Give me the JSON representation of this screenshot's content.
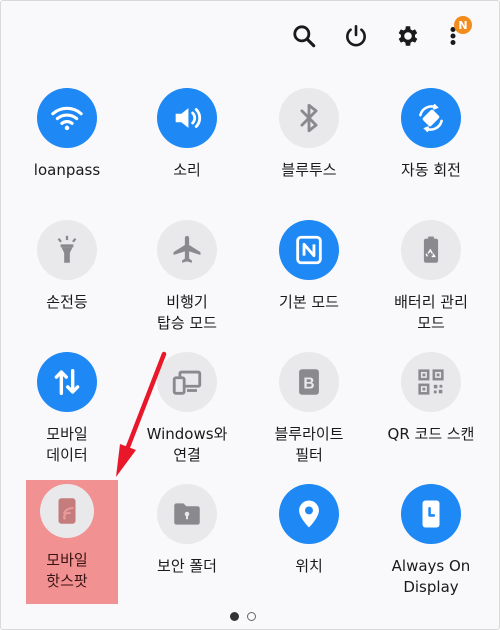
{
  "topbar": {
    "icons": [
      "search-icon",
      "power-icon",
      "settings-icon",
      "more-icon"
    ],
    "notification_badge": "N"
  },
  "tiles": [
    {
      "label": "loanpass",
      "icon": "wifi-icon",
      "state": "on"
    },
    {
      "label": "소리",
      "icon": "sound-icon",
      "state": "on"
    },
    {
      "label": "블루투스",
      "icon": "bluetooth-icon",
      "state": "off"
    },
    {
      "label": "자동 회전",
      "icon": "auto-rotate-icon",
      "state": "on"
    },
    {
      "label": "손전등",
      "icon": "flashlight-icon",
      "state": "off"
    },
    {
      "label": "비행기\n탑승 모드",
      "icon": "airplane-icon",
      "state": "off"
    },
    {
      "label": "기본 모드",
      "icon": "nfc-icon",
      "state": "on"
    },
    {
      "label": "배터리 관리\n모드",
      "icon": "battery-saver-icon",
      "state": "off"
    },
    {
      "label": "모바일\n데이터",
      "icon": "mobile-data-icon",
      "state": "on"
    },
    {
      "label": "Windows와\n연결",
      "icon": "link-to-windows-icon",
      "state": "off"
    },
    {
      "label": "블루라이트\n필터",
      "icon": "blue-light-filter-icon",
      "state": "off"
    },
    {
      "label": "QR 코드 스캔",
      "icon": "qr-code-icon",
      "state": "off"
    },
    {
      "label": "모바일\n핫스팟",
      "icon": "hotspot-icon",
      "state": "off"
    },
    {
      "label": "보안 폴더",
      "icon": "secure-folder-icon",
      "state": "off"
    },
    {
      "label": "위치",
      "icon": "location-icon",
      "state": "on"
    },
    {
      "label": "Always On\nDisplay",
      "icon": "always-on-display-icon",
      "state": "on"
    }
  ],
  "pagination": {
    "pages": 2,
    "current": 1
  },
  "colors": {
    "active": "#1e88f5",
    "inactive": "#e9e9ec",
    "highlight": "#eb5050",
    "arrow": "#e8182a",
    "badge": "#f28c1c"
  }
}
